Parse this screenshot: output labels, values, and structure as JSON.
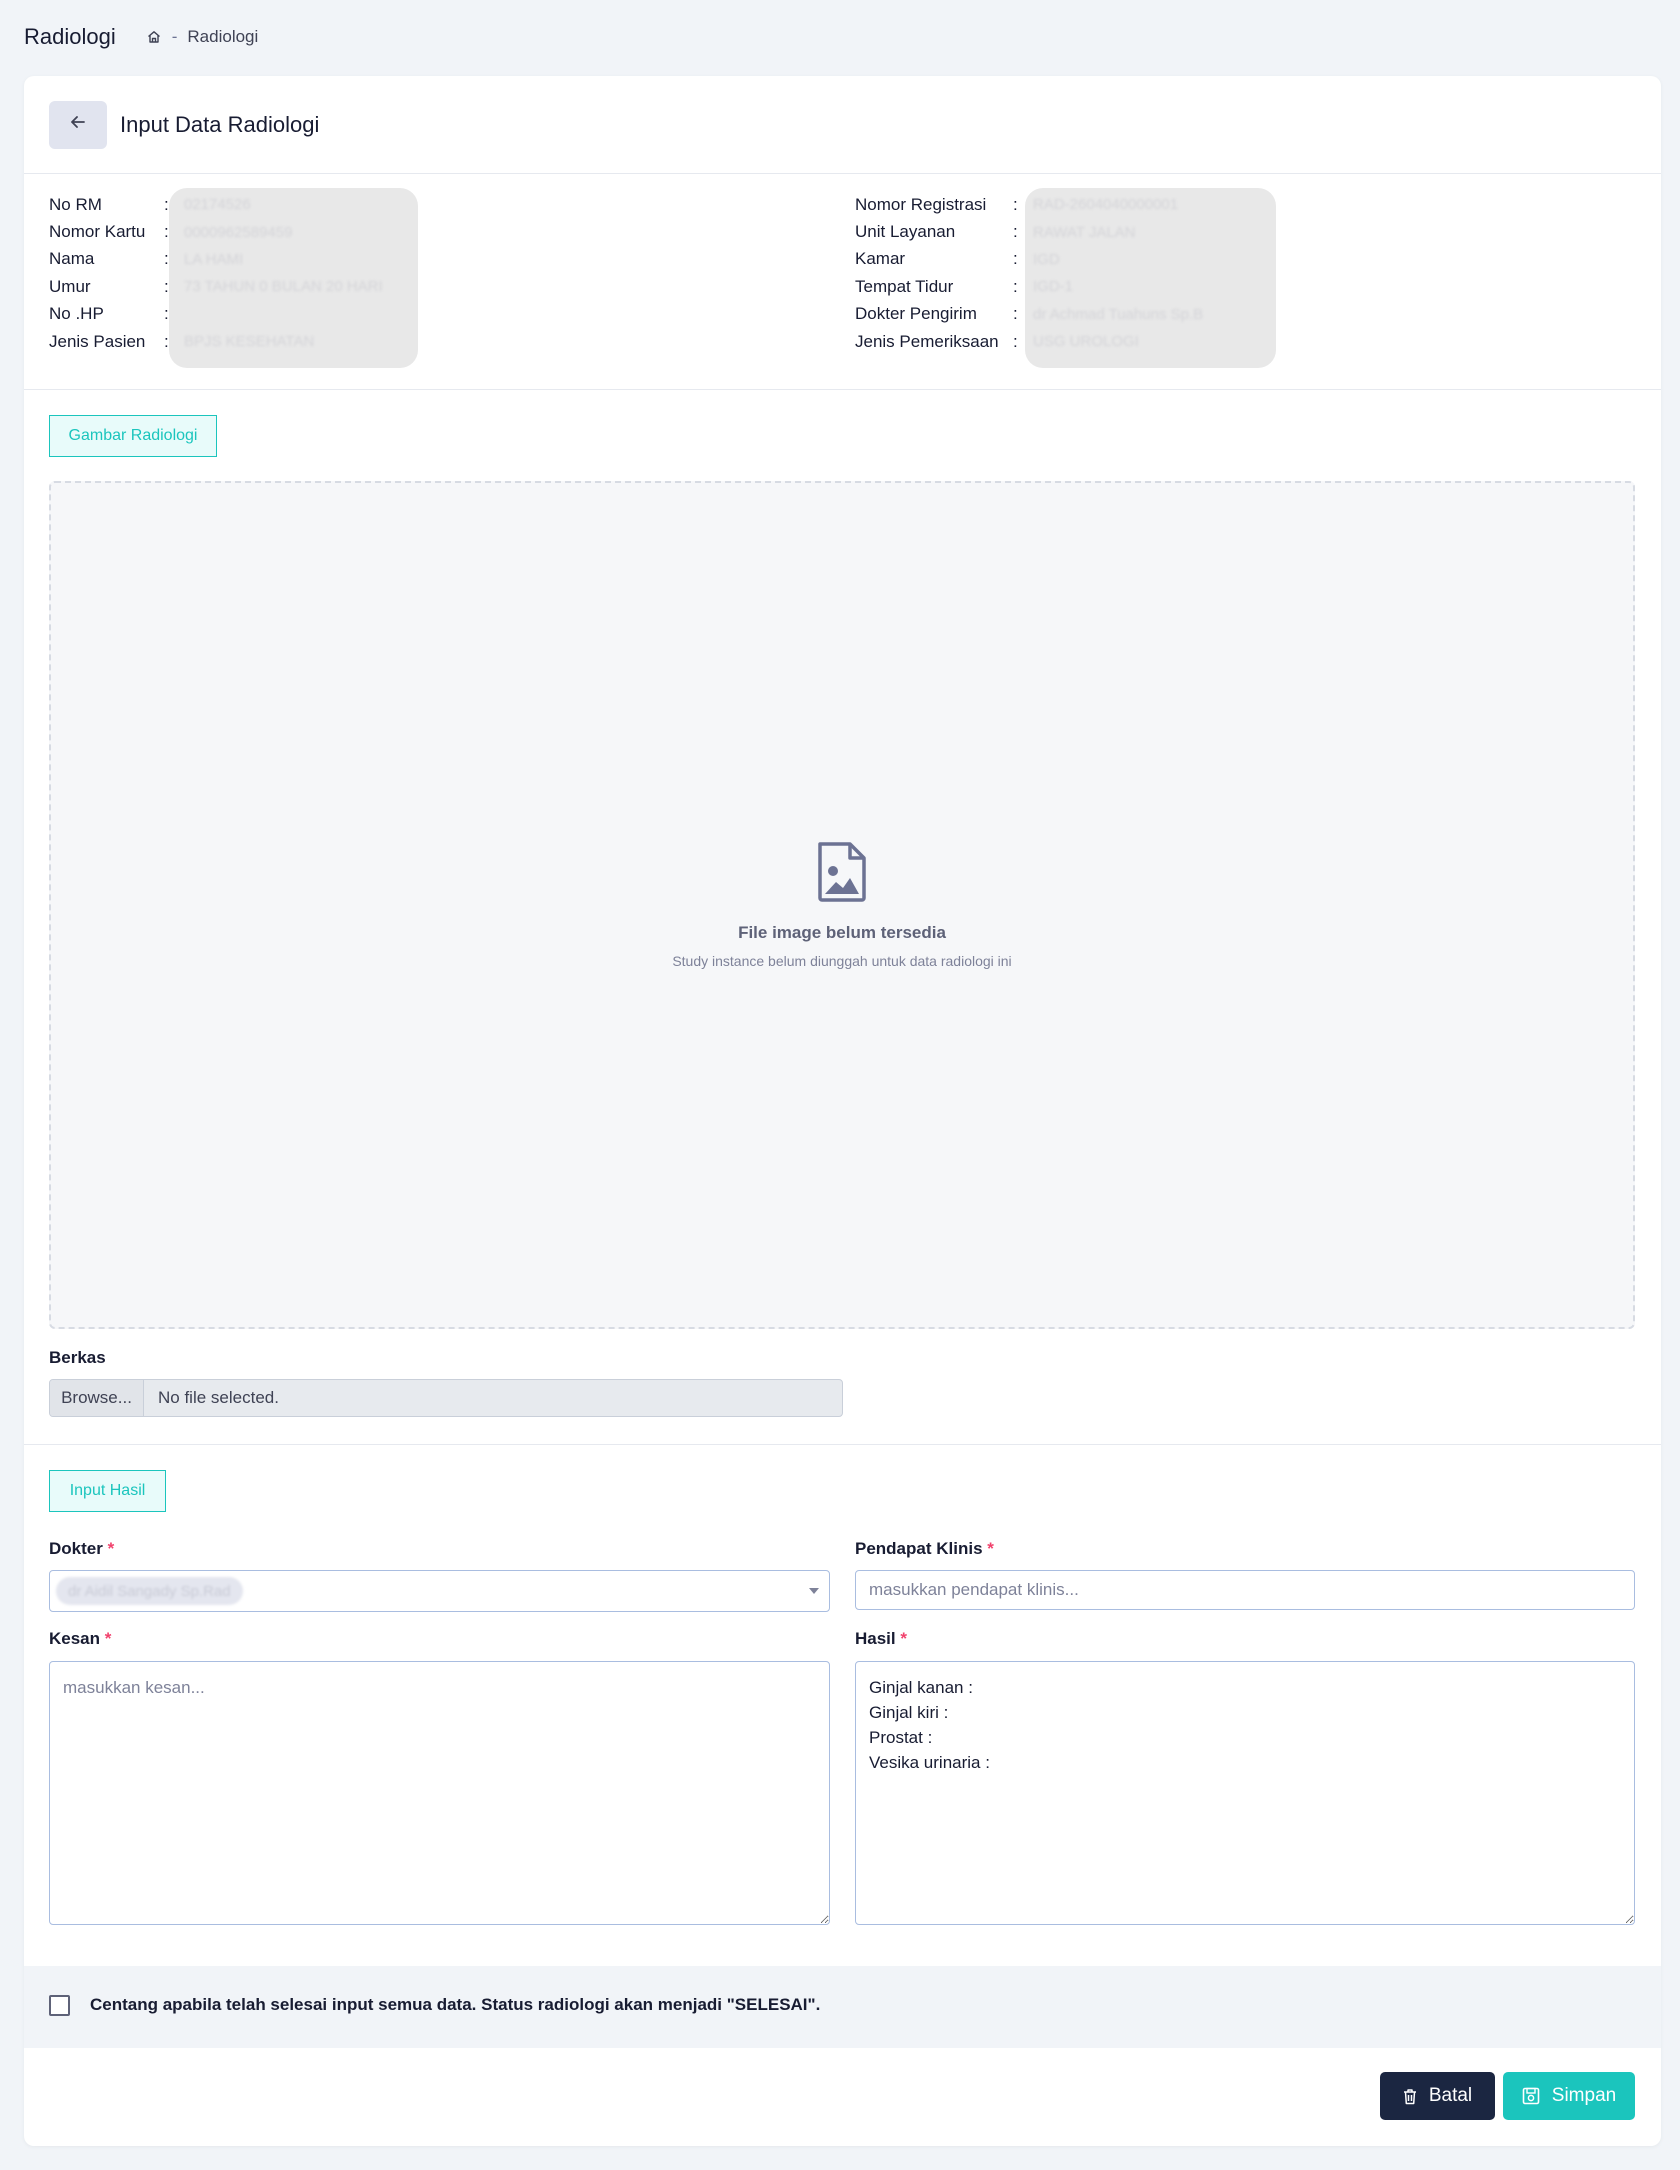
{
  "header": {
    "title": "Radiologi",
    "breadcrumb_separator": "-",
    "breadcrumb_current": "Radiologi"
  },
  "card": {
    "title": "Input Data Radiologi"
  },
  "patient_left": [
    {
      "label": "No RM",
      "value": "02174526"
    },
    {
      "label": "Nomor Kartu",
      "value": "0000962589459"
    },
    {
      "label": "Nama",
      "value": "LA HAMI"
    },
    {
      "label": "Umur",
      "value": "73 TAHUN 0 BULAN 20 HARI"
    },
    {
      "label": "No .HP",
      "value": ""
    },
    {
      "label": "Jenis Pasien",
      "value": "BPJS KESEHATAN"
    }
  ],
  "patient_right": [
    {
      "label": "Nomor Registrasi",
      "value": "RAD-2604040000001"
    },
    {
      "label": "Unit Layanan",
      "value": "RAWAT JALAN"
    },
    {
      "label": "Kamar",
      "value": "IGD"
    },
    {
      "label": "Tempat Tidur",
      "value": "IGD-1"
    },
    {
      "label": "Dokter Pengirim",
      "value": "dr Achmad Tuahuns Sp.B"
    },
    {
      "label": "Jenis Pemeriksaan",
      "value": "USG UROLOGI"
    }
  ],
  "colon": ":",
  "image_section": {
    "button_label": "Gambar Radiologi",
    "empty_title": "File image belum tersedia",
    "empty_subtitle": "Study instance belum diunggah untuk data radiologi ini"
  },
  "berkas": {
    "label": "Berkas",
    "browse_label": "Browse...",
    "file_status": "No file selected."
  },
  "hasil_section": {
    "button_label": "Input Hasil",
    "dokter_label": "Dokter",
    "dokter_value": "dr Aidil Sangady Sp.Rad",
    "pendapat_label": "Pendapat Klinis",
    "pendapat_placeholder": "masukkan pendapat klinis...",
    "kesan_label": "Kesan",
    "kesan_placeholder": "masukkan kesan...",
    "hasil_label": "Hasil",
    "hasil_value": "Ginjal kanan :\nGinjal kiri :\nProstat :\nVesika urinaria :",
    "required_mark": "*"
  },
  "confirm_text": "Centang apabila telah selesai input semua data. Status radiologi akan menjadi \"SELESAI\".",
  "actions": {
    "batal_label": "Batal",
    "simpan_label": "Simpan"
  },
  "colors": {
    "accent": "#1bc5bd",
    "dark": "#1b2641",
    "required": "#f1416c"
  }
}
